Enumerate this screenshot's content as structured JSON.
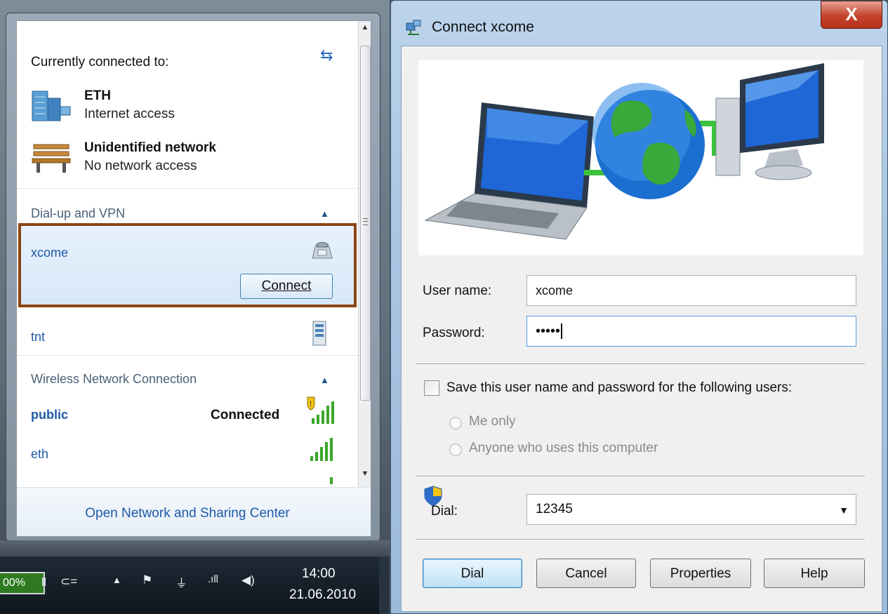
{
  "flyout": {
    "currently_connected_label": "Currently connected to:",
    "networks": [
      {
        "name": "ETH",
        "status": "Internet access",
        "icon": "building-network-icon"
      },
      {
        "name": "Unidentified network",
        "status": "No network access",
        "icon": "park-bench-icon"
      }
    ],
    "dialup_section": "Dial-up and VPN",
    "dialup_items": [
      {
        "name": "xcome",
        "icon": "telephone-modem-icon",
        "selected": true
      },
      {
        "name": "tnt",
        "icon": "vpn-server-icon",
        "selected": false
      }
    ],
    "connect_label": "Connect",
    "wireless_section": "Wireless Network Connection",
    "wireless_items": [
      {
        "name": "public",
        "state": "Connected",
        "icon": "wifi-signal-shield-icon"
      },
      {
        "name": "eth",
        "state": "",
        "icon": "wifi-signal-icon"
      }
    ],
    "footer_link": "Open Network and Sharing Center"
  },
  "taskbar": {
    "battery": "00%",
    "time": "14:00",
    "date": "21.06.2010"
  },
  "dialog": {
    "title": "Connect xcome",
    "close_label": "X",
    "username_label": "User name:",
    "username_value": "xcome",
    "password_label": "Password:",
    "password_value": "•••••",
    "save_label": "Save this user name and password for the following users:",
    "save_checked": false,
    "me_only_label": "Me only",
    "anyone_label": "Anyone who uses this computer",
    "dial_label": "Dial:",
    "dial_value": "12345",
    "buttons": {
      "dial": "Dial",
      "cancel": "Cancel",
      "properties": "Properties",
      "help": "Help"
    }
  },
  "colors": {
    "link_blue": "#1e5aa8",
    "selection_border": "#8b4513",
    "close_red": "#c4432c"
  }
}
